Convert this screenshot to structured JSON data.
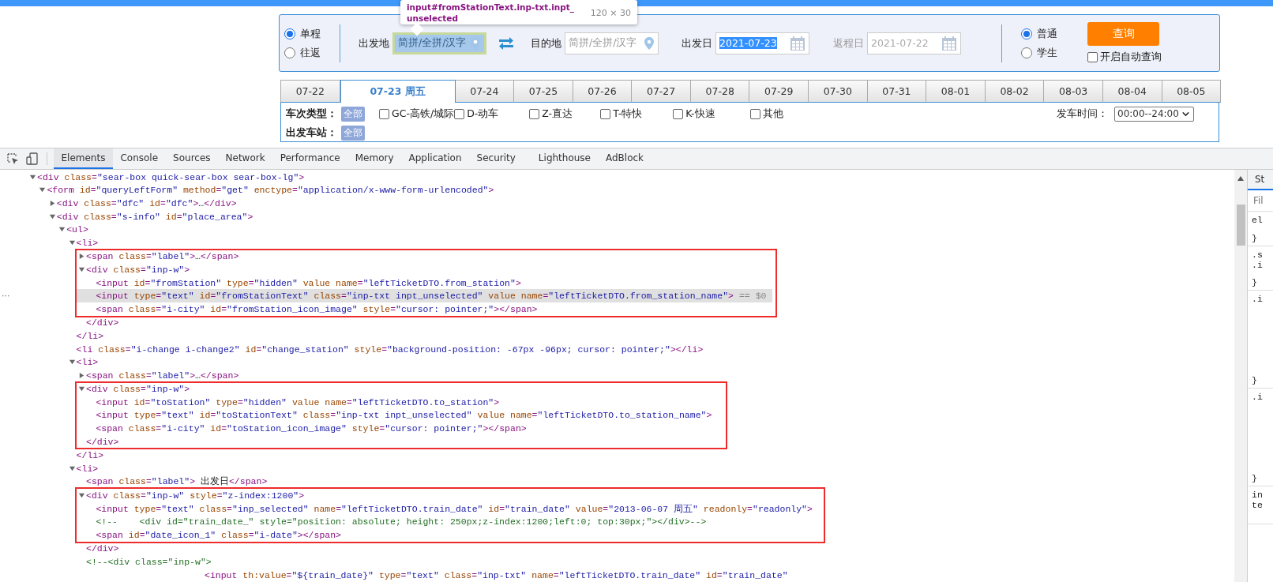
{
  "tooltip": {
    "selector_lines": [
      "input#fromStationText.inp-txt.inpt_",
      "unselected"
    ],
    "size": "120 × 30"
  },
  "search": {
    "trip_types": [
      {
        "label": "单程",
        "selected": true
      },
      {
        "label": "往返",
        "selected": false
      }
    ],
    "from": {
      "label": "出发地",
      "placeholder": "简拼/全拼/汉字",
      "inspected": true
    },
    "to": {
      "label": "目的地",
      "placeholder": "简拼/全拼/汉字",
      "inspected": false
    },
    "depart_date": {
      "label": "出发日",
      "value": "2021-07-23",
      "text_selected": true,
      "disabled": false
    },
    "return_date": {
      "label": "返程日",
      "value": "2021-07-22",
      "text_selected": false,
      "disabled": true
    },
    "passenger_types": [
      {
        "label": "普通",
        "selected": true
      },
      {
        "label": "学生",
        "selected": false
      }
    ],
    "query_button": "查询",
    "auto_query": {
      "label": "开启自动查询",
      "checked": false
    }
  },
  "date_tabs": [
    {
      "label": "07-22",
      "selected": false
    },
    {
      "label": "07-23 周五",
      "selected": true
    },
    {
      "label": "07-24",
      "selected": false
    },
    {
      "label": "07-25",
      "selected": false
    },
    {
      "label": "07-26",
      "selected": false
    },
    {
      "label": "07-27",
      "selected": false
    },
    {
      "label": "07-28",
      "selected": false
    },
    {
      "label": "07-29",
      "selected": false
    },
    {
      "label": "07-30",
      "selected": false
    },
    {
      "label": "07-31",
      "selected": false
    },
    {
      "label": "08-01",
      "selected": false
    },
    {
      "label": "08-02",
      "selected": false
    },
    {
      "label": "08-03",
      "selected": false
    },
    {
      "label": "08-04",
      "selected": false
    },
    {
      "label": "08-05",
      "selected": false
    }
  ],
  "filters": {
    "train_types": {
      "label": "车次类型：",
      "all_badge": "全部",
      "options": [
        {
          "label": "GC-高铁/城际",
          "checked": false
        },
        {
          "label": "D-动车",
          "checked": false
        },
        {
          "label": "Z-直达",
          "checked": false
        },
        {
          "label": "T-特快",
          "checked": false
        },
        {
          "label": "K-快速",
          "checked": false
        },
        {
          "label": "其他",
          "checked": false
        }
      ]
    },
    "departure_time": {
      "label": "发车时间：",
      "value": "00:00--24:00"
    },
    "departure_station": {
      "label": "出发车站：",
      "all_badge": "全部"
    }
  },
  "devtools": {
    "tabs": [
      {
        "label": "Elements",
        "selected": true
      },
      {
        "label": "Console",
        "selected": false
      },
      {
        "label": "Sources",
        "selected": false
      },
      {
        "label": "Network",
        "selected": false
      },
      {
        "label": "Performance",
        "selected": false
      },
      {
        "label": "Memory",
        "selected": false
      },
      {
        "label": "Application",
        "selected": false
      },
      {
        "label": "Security",
        "selected": false
      },
      {
        "label": "Lighthouse",
        "selected": false
      },
      {
        "label": "AdBlock",
        "selected": false
      }
    ],
    "elements_tree": [
      {
        "kind": "tag",
        "text": "<div class=\"sear-box quick-sear-box sear-box-lg\">",
        "expanded": true,
        "children": [
          {
            "kind": "tag",
            "text": "<form id=\"queryLeftForm\" method=\"get\" enctype=\"application/x-www-form-urlencoded\">",
            "expanded": true,
            "children": [
              {
                "kind": "tag",
                "text": "<div class=\"dfc\" id=\"dfc\">…</div>",
                "expanded": false
              },
              {
                "kind": "tag",
                "text": "<div class=\"s-info\" id=\"place_area\">",
                "expanded": true,
                "children": [
                  {
                    "kind": "tag",
                    "text": "<ul>",
                    "expanded": true,
                    "children": [
                      {
                        "kind": "tag",
                        "text": "<li>",
                        "expanded": true,
                        "children": [
                          {
                            "kind": "tag",
                            "text": "<span class=\"label\">…</span>",
                            "expanded": false,
                            "boxed": true
                          },
                          {
                            "kind": "tag",
                            "text": "<div class=\"inp-w\">",
                            "expanded": true,
                            "boxed": true,
                            "children": [
                              {
                                "kind": "tag",
                                "text": "<input id=\"fromStation\" type=\"hidden\" value name=\"leftTicketDTO.from_station\">",
                                "boxed": true
                              },
                              {
                                "kind": "tag",
                                "text": "<input type=\"text\" id=\"fromStationText\" class=\"inp-txt inpt_unselected\" value name=\"leftTicketDTO.from_station_name\">",
                                "boxed": true,
                                "selected": true,
                                "suffix": "== $0",
                                "gutter": "···"
                              },
                              {
                                "kind": "tag",
                                "text": "<span class=\"i-city\" id=\"fromStation_icon_image\" style=\"cursor: pointer;\"></span>",
                                "boxed": true
                              }
                            ]
                          },
                          {
                            "kind": "tag",
                            "text": "</div>"
                          }
                        ]
                      },
                      {
                        "kind": "tag",
                        "text": "</li>"
                      },
                      {
                        "kind": "tag",
                        "text": "<li class=\"i-change i-change2\" id=\"change_station\" style=\"background-position: -67px -96px; cursor: pointer;\"></li>"
                      },
                      {
                        "kind": "tag",
                        "text": "<li>",
                        "expanded": true,
                        "children": [
                          {
                            "kind": "tag",
                            "text": "<span class=\"label\">…</span>",
                            "expanded": false
                          },
                          {
                            "kind": "tag",
                            "text": "<div class=\"inp-w\">",
                            "expanded": true,
                            "boxed": true,
                            "children": [
                              {
                                "kind": "tag",
                                "text": "<input id=\"toStation\" type=\"hidden\" value name=\"leftTicketDTO.to_station\">",
                                "boxed": true
                              },
                              {
                                "kind": "tag",
                                "text": "<input type=\"text\" id=\"toStationText\" class=\"inp-txt inpt_unselected\" value name=\"leftTicketDTO.to_station_name\">",
                                "boxed": true
                              },
                              {
                                "kind": "tag",
                                "text": "<span class=\"i-city\" id=\"toStation_icon_image\" style=\"cursor: pointer;\"></span>",
                                "boxed": true
                              }
                            ]
                          },
                          {
                            "kind": "tag",
                            "text": "</div>",
                            "boxed": true
                          }
                        ]
                      },
                      {
                        "kind": "tag",
                        "text": "</li>"
                      },
                      {
                        "kind": "tag",
                        "text": "<li>",
                        "expanded": true,
                        "children": [
                          {
                            "kind": "tag",
                            "text": "<span class=\"label\"> 出发日</span>"
                          },
                          {
                            "kind": "tag",
                            "text": "<div class=\"inp-w\" style=\"z-index:1200\">",
                            "expanded": true,
                            "boxed": true,
                            "children": [
                              {
                                "kind": "tag",
                                "text": "<input type=\"text\" class=\"inp_selected\" name=\"leftTicketDTO.train_date\" id=\"train_date\" value=\"2013-06-07 周五\" readonly=\"readonly\">",
                                "boxed": true
                              },
                              {
                                "kind": "comment",
                                "text": "<!--    <div id=\"train_date_\" style=\"position: absolute; height: 250px;z-index:1200;left:0; top:30px;\"></div>-->",
                                "boxed": true
                              },
                              {
                                "kind": "tag",
                                "text": "<span id=\"date_icon_1\" class=\"i-date\"></span>",
                                "boxed": true
                              }
                            ]
                          },
                          {
                            "kind": "tag",
                            "text": "</div>"
                          },
                          {
                            "kind": "comment",
                            "text": "<!--<div class=\"inp-w\">"
                          },
                          {
                            "kind": "continuation",
                            "text": "<input th:value=\"${train_date}\" type=\"text\" class=\"inp-txt\" name=\"leftTicketDTO.train_date\" id=\"train_date\""
                          }
                        ]
                      }
                    ]
                  }
                ]
              }
            ]
          }
        ]
      }
    ],
    "styles_pane": {
      "tab": "St",
      "filter_placeholder": "Fil",
      "rules": [
        {
          "lines": [
            "el",
            "}"
          ]
        },
        {
          "lines": [
            ".s",
            ".i",
            "}"
          ]
        },
        {
          "lines": [
            ".i",
            "}"
          ]
        },
        {
          "lines": [
            ".i",
            "}"
          ]
        },
        {
          "lines": [
            "in",
            "te"
          ]
        }
      ]
    }
  }
}
